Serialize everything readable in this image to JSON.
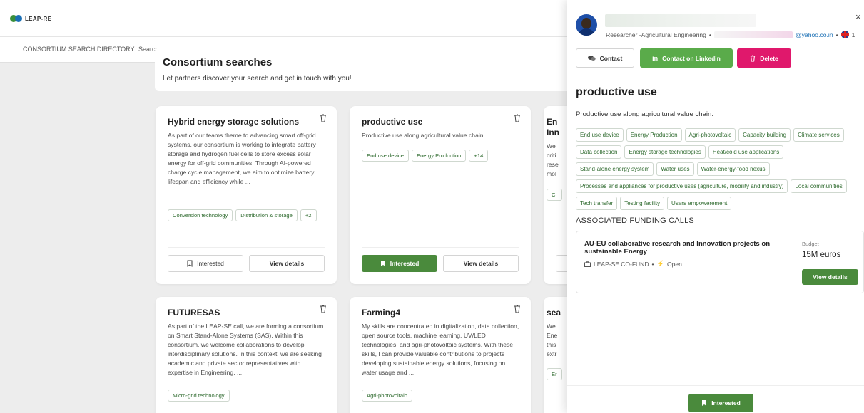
{
  "app": {
    "logo_text": "LEAP-RE",
    "logo_colors": [
      "#3a8f3a",
      "#1a6fb5"
    ]
  },
  "subnav": {
    "title": "CONSORTIUM SEARCH DIRECTORY",
    "search_label": "Search:"
  },
  "intro": {
    "title": "Consortium searches",
    "subtitle": "Let partners discover your search and get in touch with you!"
  },
  "cards": [
    {
      "title": "Hybrid energy storage solutions",
      "description": "As part of our teams theme to advancing smart off-grid systems, our consortium is working to integrate battery storage and hydrogen fuel cells to store excess solar energy for off-grid communities. Through AI-powered charge cycle management, we aim to optimize battery lifespan and efficiency while ...",
      "tags": [
        "Conversion technology",
        "Distribution & storage",
        "+2"
      ],
      "interested_label": "Interested",
      "details_label": "View details",
      "interested_active": false
    },
    {
      "title": "productive use",
      "description": "Productive use along agricultural value chain.",
      "tags": [
        "End use device",
        "Energy Production",
        "+14"
      ],
      "interested_label": "Interested",
      "details_label": "View details",
      "interested_active": true
    },
    {
      "title": "En\nInn",
      "description": "We\ncriti\nrese\nmol",
      "tags": [
        "Cr"
      ]
    },
    {
      "title": "FUTURESAS",
      "description": "As part of the LEAP-SE call, we are forming a consortium on Smart Stand-Alone Systems (SAS). Within this consortium, we welcome collaborations to develop interdisciplinary solutions. In this context, we are seeking academic and private sector representatives with expertise in Engineering, ...",
      "tags": [
        "Micro-grid technology"
      ]
    },
    {
      "title": "Farming4",
      "description": "My skills are concentrated in digitalization, data collection, open source tools, machine learning, UV/LED technologies, and agri-photovoltaic systems. With these skills, I can provide valuable contributions to projects developing sustainable energy solutions, focusing on water usage and ...",
      "tags": [
        "Agri-photovoltaic"
      ]
    },
    {
      "title": "sea",
      "description": "We\nEne\nthis\nextr",
      "tags": [
        "Er"
      ]
    }
  ],
  "panel": {
    "role": "Researcher -Agricultural Engineering",
    "email_suffix": "@yahoo.co.in",
    "language_count": "1",
    "close_label": "×",
    "contact_label": "Contact",
    "linkedin_label": "Contact on Linkedin",
    "delete_label": "Delete",
    "title": "productive use",
    "description": "Productive use along agricultural value chain.",
    "tags": [
      "End use device",
      "Energy Production",
      "Agri-photovoltaic",
      "Capacity building",
      "Climate services",
      "Data collection",
      "Energy storage technologies",
      "Heat/cold use applications",
      "Stand-alone energy system",
      "Water uses",
      "Water-energy-food nexus",
      "Processes and appliances for productive uses (agriculture, mobility and industry)",
      "Local communities",
      "Tech transfer",
      "Testing facility",
      "Users empowerement"
    ],
    "funding_heading": "ASSOCIATED FUNDING CALLS",
    "funding": {
      "title": "AU-EU collaborative research and Innovation projects on sustainable Energy",
      "program": "LEAP-SE CO-FUND",
      "status": "Open",
      "budget_label": "Budget",
      "budget_value": "15M euros",
      "details_label": "View details"
    },
    "interested_label": "Interested"
  },
  "colors": {
    "green": "#4a8a3c",
    "linkedin_green": "#5aab4a",
    "delete_pink": "#e0186c",
    "tag_text": "#2f6b2f"
  }
}
